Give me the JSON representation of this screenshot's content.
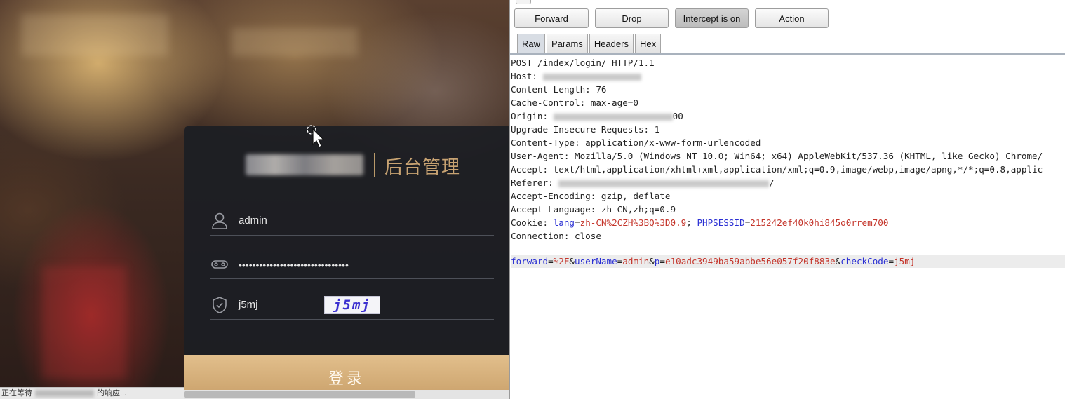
{
  "browser": {
    "page_title": "后台管理",
    "username_value": "admin",
    "password_dots": "••••••••••••••••••••••••••••••••",
    "captcha_value": "j5mj",
    "captcha_image_text": "j5mj",
    "login_button_label": "登录",
    "status_prefix": "正在等待",
    "status_suffix": "的响应..."
  },
  "burp": {
    "buttons": {
      "forward": "Forward",
      "drop": "Drop",
      "intercept": "Intercept is on",
      "action": "Action"
    },
    "tabs": [
      "Raw",
      "Params",
      "Headers",
      "Hex"
    ],
    "request": {
      "request_line": "POST /index/login/ HTTP/1.1",
      "host_label": "Host:",
      "content_length": "Content-Length: 76",
      "cache_control": "Cache-Control: max-age=0",
      "origin_label": "Origin:",
      "origin_tail": "00",
      "upgrade": "Upgrade-Insecure-Requests: 1",
      "content_type": "Content-Type: application/x-www-form-urlencoded",
      "user_agent": "User-Agent: Mozilla/5.0 (Windows NT 10.0; Win64; x64) AppleWebKit/537.36 (KHTML, like Gecko) Chrome/",
      "accept": "Accept: text/html,application/xhtml+xml,application/xml;q=0.9,image/webp,image/apng,*/*;q=0.8,applic",
      "referer_label": "Referer:",
      "referer_tail": "/",
      "accept_encoding": "Accept-Encoding: gzip, deflate",
      "accept_language": "Accept-Language: zh-CN,zh;q=0.9",
      "cookie": {
        "label": "Cookie: ",
        "p1_name": "lang",
        "p1_value": "zh-CN%2CZH%3BQ%3D0.9",
        "sep": "; ",
        "p2_name": "PHPSESSID",
        "p2_value": "215242ef40k0hi845o0rrem700"
      },
      "connection": "Connection: close",
      "body": {
        "p1_name": "forward",
        "p1_value": "%2F",
        "p2_name": "userName",
        "p2_value": "admin",
        "p3_name": "p",
        "p3_value": "e10adc3949ba59abbe56e057f20f883e",
        "p4_name": "checkCode",
        "p4_value": "j5mj"
      }
    }
  }
}
